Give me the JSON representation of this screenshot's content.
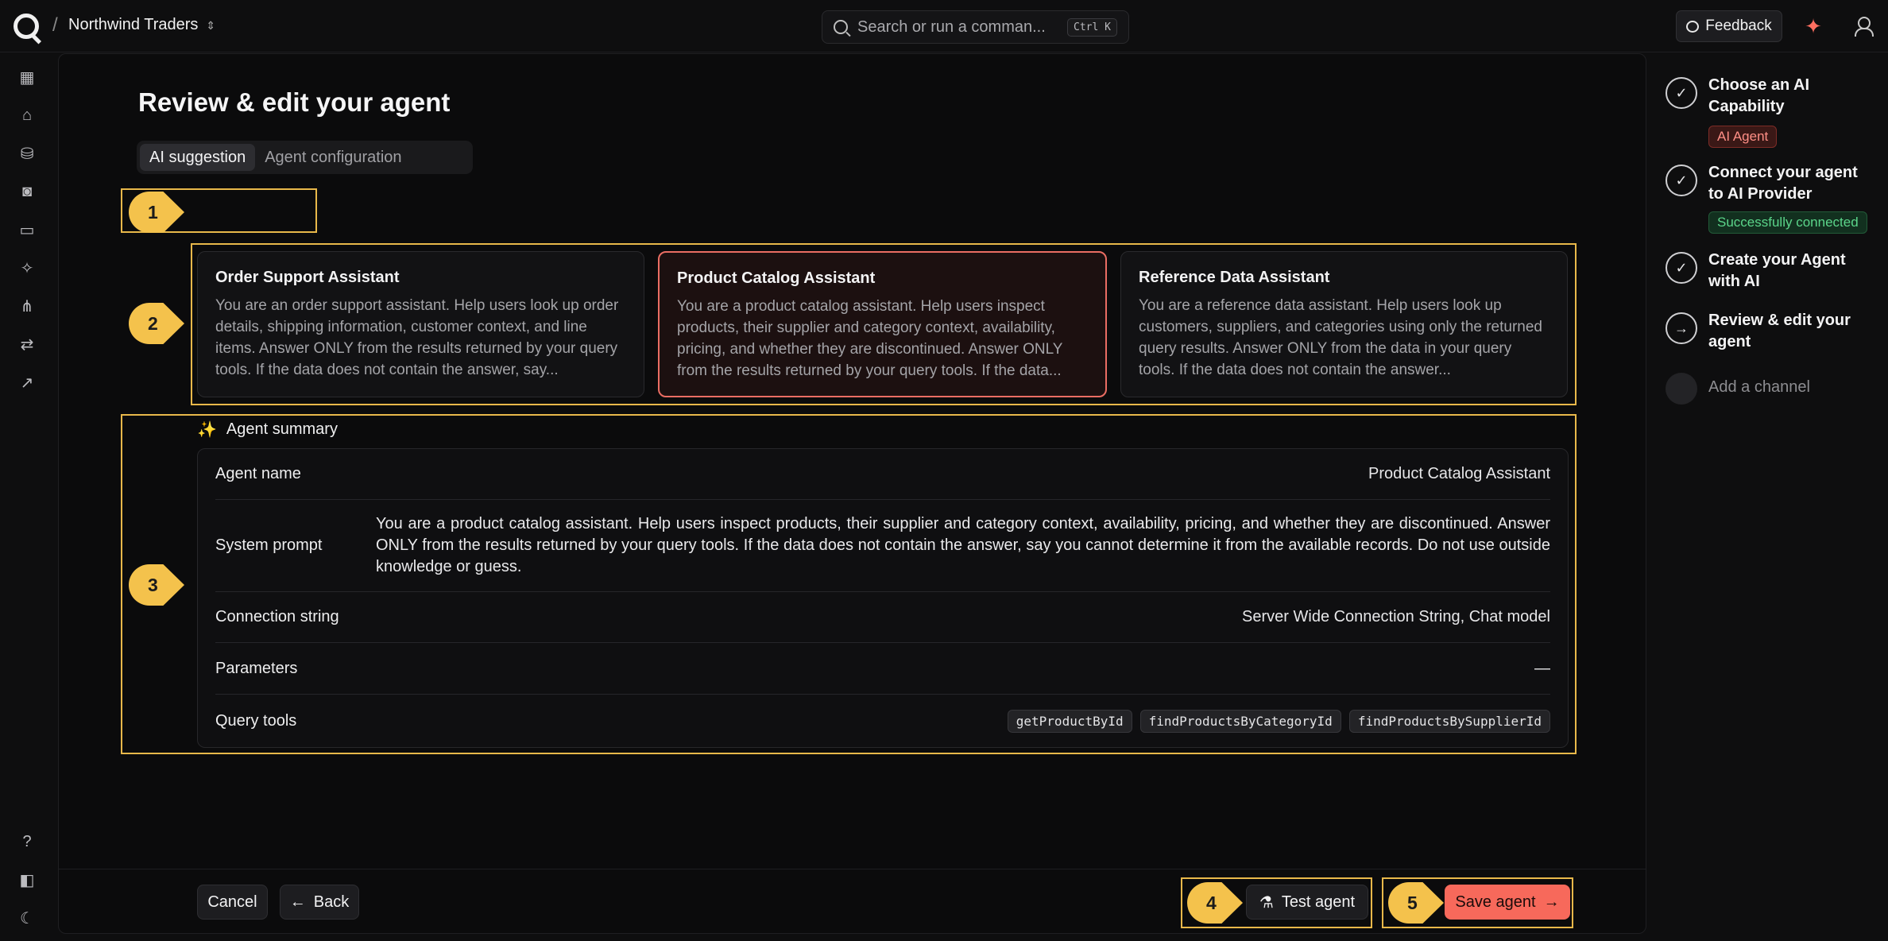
{
  "header": {
    "workspace": "Northwind Traders",
    "search_placeholder": "Search or run a comman...",
    "search_shortcut": "Ctrl K",
    "feedback_label": "Feedback"
  },
  "page": {
    "title": "Review & edit your agent",
    "tabs": [
      {
        "label": "AI suggestion",
        "active": true
      },
      {
        "label": "Agent configuration",
        "active": false
      }
    ]
  },
  "markers": [
    "1",
    "2",
    "3",
    "4",
    "5"
  ],
  "suggestions": [
    {
      "title": "Order Support Assistant",
      "body": "You are an order support assistant. Help users look up order details, shipping information, customer context, and line items. Answer ONLY from the results returned by your query tools. If the data does not contain the answer, say...",
      "selected": false
    },
    {
      "title": "Product Catalog Assistant",
      "body": "You are a product catalog assistant. Help users inspect products, their supplier and category context, availability, pricing, and whether they are discontinued. Answer ONLY from the results returned by your query tools. If the data...",
      "selected": true
    },
    {
      "title": "Reference Data Assistant",
      "body": "You are a reference data assistant. Help users look up customers, suppliers, and categories using only the returned query results. Answer ONLY from the data in your query tools. If the data does not contain the answer...",
      "selected": false
    }
  ],
  "summary": {
    "heading": "Agent summary",
    "rows": [
      {
        "label": "Agent name",
        "value": "Product Catalog Assistant"
      },
      {
        "label": "System prompt",
        "value": "You are a product catalog assistant. Help users inspect products, their supplier and category context, availability, pricing, and whether they are discontinued. Answer ONLY from the results returned by your query tools. If the data does not contain the answer, say you cannot determine it from the available records. Do not use outside knowledge or guess."
      },
      {
        "label": "Connection string",
        "value": "Server Wide Connection String, Chat model"
      },
      {
        "label": "Parameters",
        "value": "—"
      },
      {
        "label": "Query tools",
        "tools": [
          "getProductById",
          "findProductsByCategoryId",
          "findProductsBySupplierId"
        ]
      }
    ]
  },
  "footer": {
    "cancel": "Cancel",
    "back": "Back",
    "test": "Test agent",
    "save": "Save agent"
  },
  "steps": [
    {
      "title": "Choose an AI Capability",
      "badge": "AI Agent",
      "badge_color": "#ff8f86",
      "state": "done"
    },
    {
      "title": "Connect your agent to AI Provider",
      "badge": "Successfully connected",
      "badge_color": "#5bd58a",
      "state": "done"
    },
    {
      "title": "Create your Agent with AI",
      "state": "done"
    },
    {
      "title": "Review & edit your agent",
      "state": "current"
    },
    {
      "title": "Add a channel",
      "state": "pending"
    }
  ],
  "colors": {
    "accent": "#f7695b",
    "highlight_outline": "#e8b84a",
    "marker": "#f4c24c"
  }
}
